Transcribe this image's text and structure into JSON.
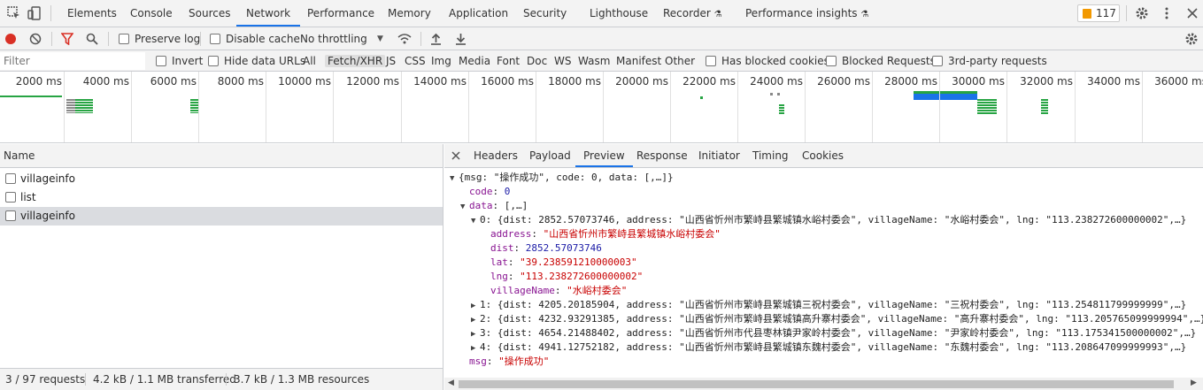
{
  "tabs": [
    "Elements",
    "Console",
    "Sources",
    "Network",
    "Performance",
    "Memory",
    "Application",
    "Security",
    "Lighthouse",
    "Recorder",
    "Performance insights"
  ],
  "issues_count": "117",
  "toolbar": {
    "preserve_log": "Preserve log",
    "disable_cache": "Disable cache",
    "throttling": "No throttling"
  },
  "filter": {
    "placeholder": "Filter",
    "invert": "Invert",
    "hide_data_urls": "Hide data URLs",
    "types": [
      "All",
      "Fetch/XHR",
      "JS",
      "CSS",
      "Img",
      "Media",
      "Font",
      "Doc",
      "WS",
      "Wasm",
      "Manifest",
      "Other"
    ],
    "has_blocked_cookies": "Has blocked cookies",
    "blocked_requests": "Blocked Requests",
    "third_party": "3rd-party requests"
  },
  "timeline_ticks": [
    "2000 ms",
    "4000 ms",
    "6000 ms",
    "8000 ms",
    "10000 ms",
    "12000 ms",
    "14000 ms",
    "16000 ms",
    "18000 ms",
    "20000 ms",
    "22000 ms",
    "24000 ms",
    "26000 ms",
    "28000 ms",
    "30000 ms",
    "32000 ms",
    "34000 ms",
    "36000 ms"
  ],
  "name_header": "Name",
  "requests": [
    "villageinfo",
    "list",
    "villageinfo"
  ],
  "status": {
    "requests": "3 / 97 requests",
    "transferred": "4.2 kB / 1.1 MB transferred",
    "resources": "3.7 kB / 1.3 MB resources"
  },
  "detail_tabs": [
    "Headers",
    "Payload",
    "Preview",
    "Response",
    "Initiator",
    "Timing",
    "Cookies"
  ],
  "preview": {
    "root": "{msg: \"操作成功\", code: 0, data: [,…]}",
    "code_key": "code",
    "code_val": "0",
    "data_key": "data",
    "data_val": "[,…]",
    "item0": "0: {dist: 2852.57073746, address: \"山西省忻州市繁峙县繁城镇水峪村委会\", villageName: \"水峪村委会\", lng: \"113.238272600000002\",…}",
    "address_key": "address",
    "address_val": "\"山西省忻州市繁峙县繁城镇水峪村委会\"",
    "dist_key": "dist",
    "dist_val": "2852.57073746",
    "lat_key": "lat",
    "lat_val": "\"39.238591210000003\"",
    "lng_key": "lng",
    "lng_val": "\"113.238272600000002\"",
    "vn_key": "villageName",
    "vn_val": "\"水峪村委会\"",
    "item1": "1: {dist: 4205.20185904, address: \"山西省忻州市繁峙县繁城镇三祝村委会\", villageName: \"三祝村委会\", lng: \"113.254811799999999\",…}",
    "item2": "2: {dist: 4232.93291385, address: \"山西省忻州市繁峙县繁城镇高升寨村委会\", villageName: \"高升寨村委会\", lng: \"113.205765099999994\",…}",
    "item3": "3: {dist: 4654.21488402, address: \"山西省忻州市代县枣林镇尹家岭村委会\", villageName: \"尹家岭村委会\", lng: \"113.175341500000002\",…}",
    "item4": "4: {dist: 4941.12752182, address: \"山西省忻州市繁峙县繁城镇东魏村委会\", villageName: \"东魏村委会\", lng: \"113.208647099999993\",…}",
    "msg_key": "msg",
    "msg_val": "\"操作成功\""
  },
  "colors": {
    "accent": "#1a73e8",
    "record": "#d93025",
    "key": "#881391",
    "string": "#c80000",
    "number": "#1a1aa6"
  }
}
